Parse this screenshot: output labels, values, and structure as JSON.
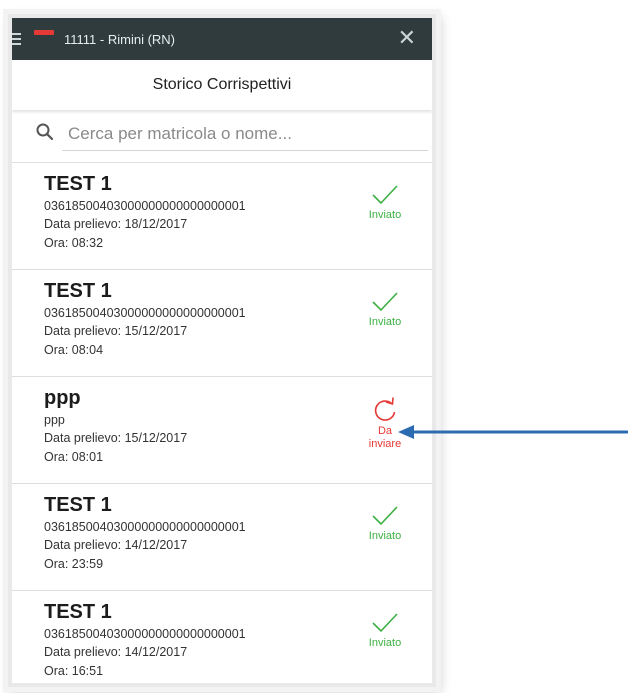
{
  "appbar": {
    "title": "11111 - Rimini (RN)",
    "close_label": "✕"
  },
  "header": {
    "title": "Storico Corrispettivi"
  },
  "search": {
    "placeholder": "Cerca per matricola o nome..."
  },
  "items": [
    {
      "title": "TEST 1",
      "code": "03618500403000000000000000001",
      "date": "Data prelievo: 18/12/2017",
      "time": "Ora: 08:32",
      "status": "Inviato"
    },
    {
      "title": "TEST 1",
      "code": "03618500403000000000000000001",
      "date": "Data prelievo: 15/12/2017",
      "time": "Ora: 08:04",
      "status": "Inviato"
    },
    {
      "title": "ppp",
      "code": "ppp",
      "date": "Data prelievo: 15/12/2017",
      "time": "Ora: 08:01",
      "status_line1": "Da",
      "status_line2": "inviare"
    },
    {
      "title": "TEST 1",
      "code": "03618500403000000000000000001",
      "date": "Data prelievo: 14/12/2017",
      "time": "Ora: 23:59",
      "status": "Inviato"
    },
    {
      "title": "TEST 1",
      "code": "03618500403000000000000000001",
      "date": "Data prelievo: 14/12/2017",
      "time": "Ora: 16:51",
      "status": "Inviato"
    }
  ],
  "colors": {
    "appbar": "#2f3b3d",
    "sent": "#3cb043",
    "pending": "#e53935",
    "annotation_arrow": "#2b6cb0"
  }
}
